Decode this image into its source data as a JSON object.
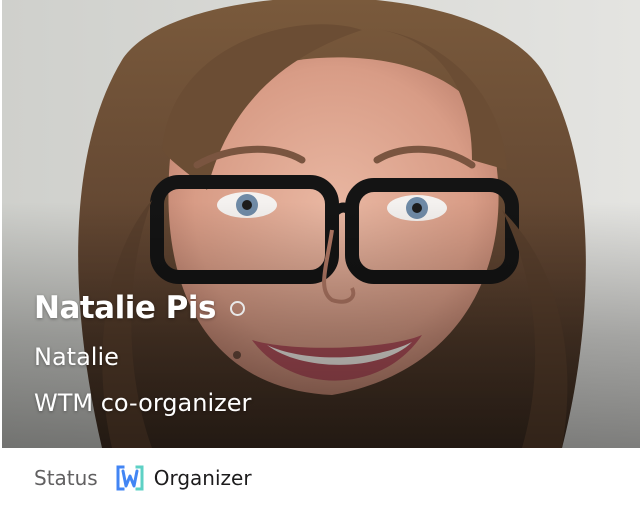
{
  "profile": {
    "display_name": "Natalie Pis",
    "real_name": "Natalie",
    "title": "WTM co-organizer",
    "presence": "away"
  },
  "status": {
    "label": "Status",
    "emoji_icon": "wtm-logo-icon",
    "value": "Organizer"
  },
  "colors": {
    "presence_ring": "#e8e8e8",
    "status_label": "#616061",
    "status_value": "#1d1c1d",
    "emoji_blue": "#4285f4",
    "emoji_teal": "#5ed1c5"
  }
}
